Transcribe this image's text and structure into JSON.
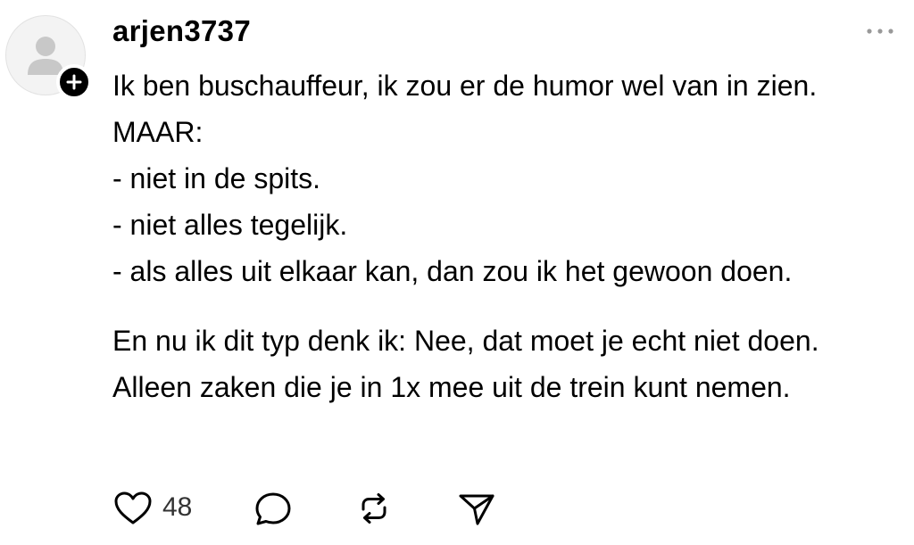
{
  "post": {
    "username": "arjen3737",
    "body_lines": [
      "Ik ben buschauffeur, ik zou er de humor wel van in zien.",
      "MAAR:",
      "- niet in de spits.",
      "- niet alles tegelijk.",
      "- als alles uit elkaar kan, dan zou ik het gewoon doen."
    ],
    "body_lines_2": [
      "En nu ik dit typ denk ik: Nee, dat moet je echt niet doen.",
      "Alleen zaken die je in 1x mee uit de trein kunt nemen."
    ],
    "like_count": "48"
  },
  "icons": {
    "avatar": "default-avatar-icon",
    "follow": "plus-icon",
    "more": "more-horizontal-icon",
    "like": "heart-icon",
    "reply": "comment-bubble-icon",
    "repost": "repost-icon",
    "share": "send-icon"
  },
  "colors": {
    "text": "#000000",
    "muted": "#999999",
    "avatar_bg": "#f3f3f3",
    "avatar_figure": "#c8c8c8"
  }
}
